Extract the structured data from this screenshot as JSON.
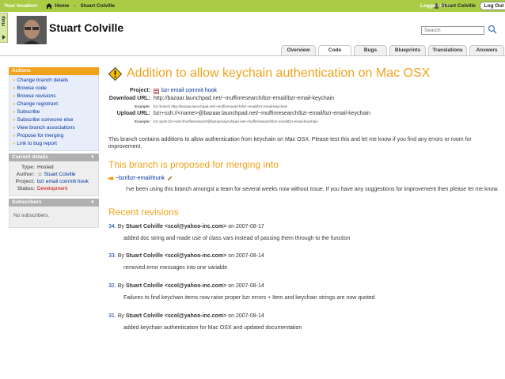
{
  "topbar": {
    "location_label": "Your location:",
    "crumbs": [
      "Home",
      "Stuart Colville"
    ],
    "logged_in_label": "Logged in as",
    "logged_in_user": "Stuart Colville",
    "logout_label": "Log Out"
  },
  "help_tab": {
    "label": "Help"
  },
  "header": {
    "owner_name": "Stuart Colville",
    "search_placeholder": "Search"
  },
  "tabs": [
    {
      "label": "Overview",
      "active": false
    },
    {
      "label": "Code",
      "active": true
    },
    {
      "label": "Bugs",
      "active": false
    },
    {
      "label": "Blueprints",
      "active": false
    },
    {
      "label": "Translations",
      "active": false
    },
    {
      "label": "Answers",
      "active": false
    }
  ],
  "sidebar": {
    "actions_title": "Actions",
    "actions": [
      "Change branch details",
      "Browse code",
      "Browse revisions",
      "Change registrant",
      "Subscribe",
      "Subscribe someone else",
      "View branch associations",
      "Propose for merging",
      "Link to bug report"
    ],
    "details_title": "Current details",
    "details": {
      "type_label": "Type:",
      "type_value": "Hosted",
      "author_label": "Author:",
      "author_value": "Stuart Colville",
      "project_label": "Project:",
      "project_value": "bzr email commit hook",
      "status_label": "Status:",
      "status_value": "Development"
    },
    "subscribers_title": "Subscribers",
    "subscribers_empty": "No subscribers."
  },
  "branch": {
    "title": "Addition to allow keychain authentication on Mac OSX",
    "project_label": "Project:",
    "project_value": "bzr email commit hook",
    "download_label": "Download URL:",
    "download_value": "http://bazaar.launchpad.net/~muffinresearch/bzr-email/bzr-email-keychain",
    "download_example_label": "Example:",
    "download_example_value": "bzr branch http://bazaar.launchpad.net/~muffinresearch/bzr-email/bzr-email-keychain",
    "upload_label": "Upload URL:",
    "upload_value": "bzr+ssh://<name>@bazaar.launchpad.net/~muffinresearch/bzr-email/bzr-email-keychain",
    "upload_example_label": "Example:",
    "upload_example_value": "bzr push bzr+ssh://muffinresearch@bazaar.launchpad.net/~muffinresearch/bzr-email/bzr-email-keychain",
    "description": "This branch contains additions to allow authentication from keychain on Mac OSX. Please test this and let me know if you find any errors or room for improvement."
  },
  "merge": {
    "heading": "This branch is proposed for merging into",
    "target": "~bzr/bzr-email/trunk",
    "note": "I've been using this branch amongst a team for several weeks now without issue. If you have any suggestions for improvement then please let me know."
  },
  "revisions": {
    "heading": "Recent revisions",
    "items": [
      {
        "num": "34.",
        "by": "By",
        "author": "Stuart Colville <scol@yahoo-inc.com>",
        "on": "on 2007-08-17",
        "message": "added doc string and made use of class vars instead of passing them through to the function"
      },
      {
        "num": "33.",
        "by": "By",
        "author": "Stuart Colville <scol@yahoo-inc.com>",
        "on": "on 2007-08-14",
        "message": "removed error messages into one variable"
      },
      {
        "num": "32.",
        "by": "By",
        "author": "Stuart Colville <scol@yahoo-inc.com>",
        "on": "on 2007-08-14",
        "message": "Failures to find keychain items now raise proper bzr errors + Item and keychain strings are now quoted"
      },
      {
        "num": "31.",
        "by": "By",
        "author": "Stuart Colville <scol@yahoo-inc.com>",
        "on": "on 2007-08-14",
        "message": "added keychain authentication for Mac OSX and updated documentation"
      }
    ]
  },
  "colors": {
    "brand_green": "#aacc44",
    "accent_orange": "#f0a21c",
    "link_blue": "#0033a0"
  }
}
